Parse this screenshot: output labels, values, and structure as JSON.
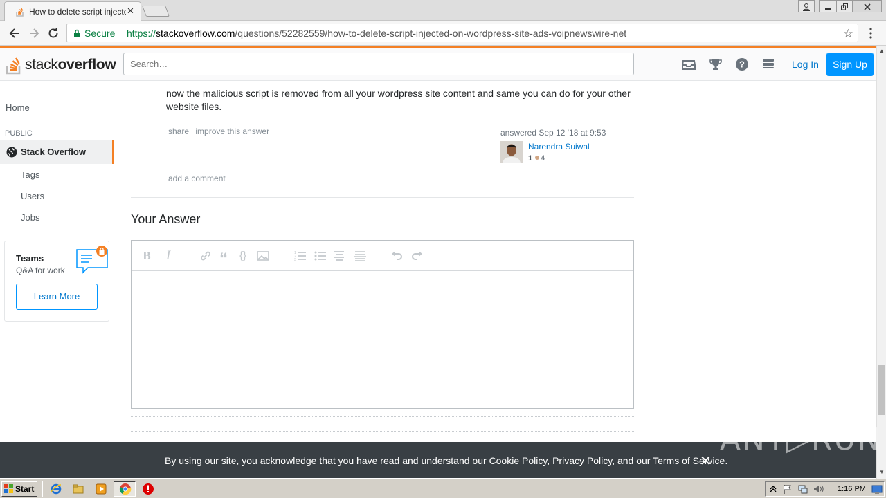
{
  "browser": {
    "tab_title": "How to delete script injected",
    "tab_close": "✕",
    "secure_label": "Secure",
    "url_scheme": "https://",
    "url_host": "stackoverflow.com",
    "url_path": "/questions/52282559/how-to-delete-script-injected-on-wordpress-site-ads-voipnewswire-net"
  },
  "header": {
    "logo_text_1": "stack",
    "logo_text_2": "overflow",
    "search_placeholder": "Search…",
    "login_label": "Log In",
    "signup_label": "Sign Up",
    "icons": [
      "inbox-icon",
      "trophy-icon",
      "help-icon",
      "site-switcher-icon"
    ],
    "accent_color": "#f48024",
    "brand_blue": "#0095ff"
  },
  "leftnav": {
    "home": "Home",
    "public_heading": "PUBLIC",
    "stack_overflow": "Stack Overflow",
    "tags": "Tags",
    "users": "Users",
    "jobs": "Jobs",
    "teams_title": "Teams",
    "teams_subtitle": "Q&A for work",
    "learn_more": "Learn More"
  },
  "answer": {
    "text": "now the malicious script is removed from all your wordpress site content and same you can do for your other website files.",
    "share_label": "share",
    "improve_label": "improve this answer",
    "answered_text": "answered Sep 12 '18 at 9:53",
    "user_name": "Narendra Suiwal",
    "reputation": "1",
    "bronze_badges": "4",
    "add_comment": "add a comment"
  },
  "your_answer": {
    "heading": "Your Answer",
    "toolbar_buttons": [
      "bold-icon",
      "italic-icon",
      "link-icon",
      "quote-icon",
      "code-icon",
      "image-icon",
      "numbered-list-icon",
      "bulleted-list-icon",
      "heading-icon",
      "horizontal-rule-icon",
      "undo-icon",
      "redo-icon"
    ]
  },
  "cookie_banner": {
    "text_1": "By using our site, you acknowledge that you have read and understand our ",
    "cookie_policy": "Cookie Policy",
    "comma": ", ",
    "privacy_policy": "Privacy Policy",
    "and_our": ", and our ",
    "terms": "Terms of Service",
    "period": ".",
    "close": "✕"
  },
  "watermark": "ANY▷RUN",
  "taskbar": {
    "start_label": "Start",
    "clock": "1:16 PM"
  }
}
